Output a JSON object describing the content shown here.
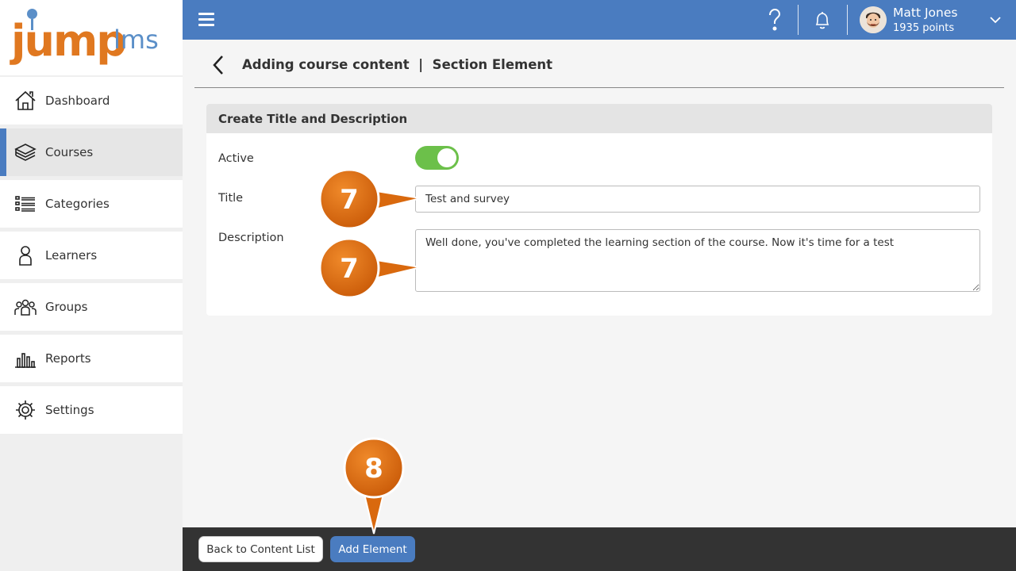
{
  "app": {
    "logo_main": "jump",
    "logo_sub": "lms"
  },
  "sidebar": {
    "items": [
      {
        "label": "Dashboard",
        "icon": "home-icon",
        "active": false
      },
      {
        "label": "Courses",
        "icon": "books-icon",
        "active": true
      },
      {
        "label": "Categories",
        "icon": "list-icon",
        "active": false
      },
      {
        "label": "Learners",
        "icon": "person-icon",
        "active": false
      },
      {
        "label": "Groups",
        "icon": "group-icon",
        "active": false
      },
      {
        "label": "Reports",
        "icon": "bar-chart-icon",
        "active": false
      },
      {
        "label": "Settings",
        "icon": "gear-icon",
        "active": false
      }
    ]
  },
  "topbar": {
    "user_name": "Matt Jones",
    "user_points": "1935 points"
  },
  "header": {
    "title": "Adding course content  |  Section Element"
  },
  "card": {
    "heading": "Create Title and Description",
    "active_label": "Active",
    "active_on": true,
    "title_label": "Title",
    "title_value": "Test and survey",
    "description_label": "Description",
    "description_value": "Well done, you've completed the learning section of the course. Now it's time for a test"
  },
  "footer": {
    "back_label": "Back to Content List",
    "add_label": "Add Element"
  },
  "callouts": {
    "title_step": "7",
    "description_step": "7",
    "add_step": "8"
  },
  "colors": {
    "brand_blue": "#4a7cc0",
    "brand_orange": "#e07820",
    "toggle_green": "#6cc04a",
    "callout_orange": "#d9690e"
  }
}
